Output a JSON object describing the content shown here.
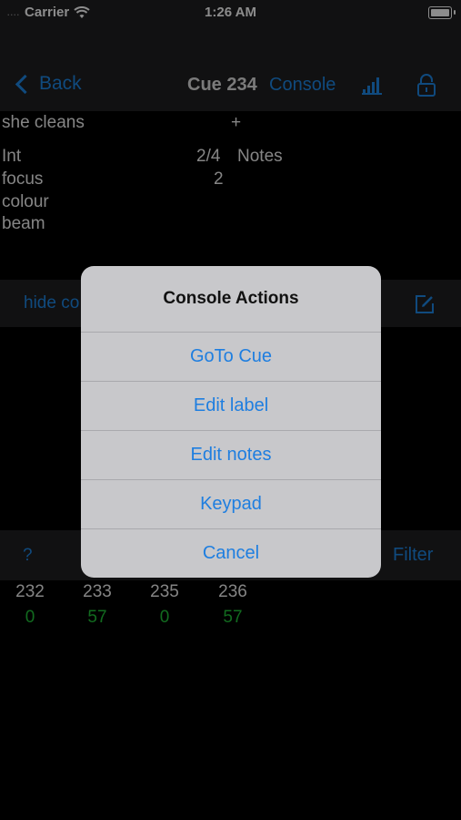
{
  "status_bar": {
    "carrier": "Carrier",
    "signal": "....",
    "time": "1:26 AM"
  },
  "nav": {
    "back_label": "Back",
    "title": "Cue 234",
    "console_label": "Console"
  },
  "info": {
    "row1_label": "she cleans",
    "row1_plus": "+",
    "int_label": "Int",
    "int_value": "2/4",
    "notes_label": "Notes",
    "focus_label": "focus",
    "focus_value": "2",
    "colour_label": "colour",
    "beam_label": "beam"
  },
  "action_bar": {
    "hide_label": "hide co"
  },
  "channel_bar": {
    "help_label": "?",
    "filter_label": "Filter"
  },
  "channels": [
    {
      "num": "232",
      "level": "0"
    },
    {
      "num": "233",
      "level": "57"
    },
    {
      "num": "235",
      "level": "0"
    },
    {
      "num": "236",
      "level": "57"
    }
  ],
  "dialog": {
    "title": "Console Actions",
    "options": [
      "GoTo Cue",
      "Edit label",
      "Edit notes",
      "Keypad",
      "Cancel"
    ]
  },
  "colors": {
    "accent": "#1e88e5",
    "level_green": "#22c33a",
    "bar_bg": "#1f1f21"
  }
}
